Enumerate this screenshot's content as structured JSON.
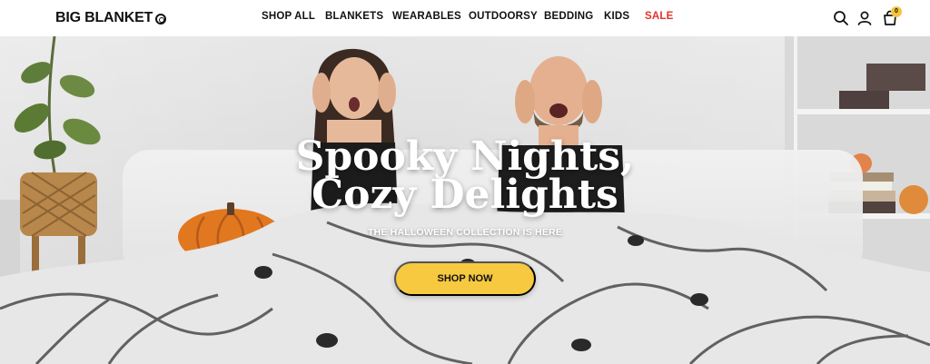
{
  "brand": {
    "name": "BIG BLANKET"
  },
  "nav": {
    "items": [
      {
        "label": "SHOP ALL"
      },
      {
        "label": "BLANKETS"
      },
      {
        "label": "WEARABLES"
      },
      {
        "label": "OUTDOORSY"
      },
      {
        "label": "BEDDING"
      },
      {
        "label": "KIDS"
      },
      {
        "label": "SALE"
      }
    ],
    "sale_color": "#e4312a"
  },
  "header_icons": {
    "search": "search-icon",
    "account": "user-icon",
    "cart": "shopping-bag-icon",
    "cart_count": "0"
  },
  "hero": {
    "headline_line1": "Spooky Nights,",
    "headline_line2": "Cozy Delights",
    "subhead": "THE HALLOWEEN COLLECTION IS HERE",
    "cta_label": "SHOP NOW",
    "cta_color": "#f6c940"
  }
}
